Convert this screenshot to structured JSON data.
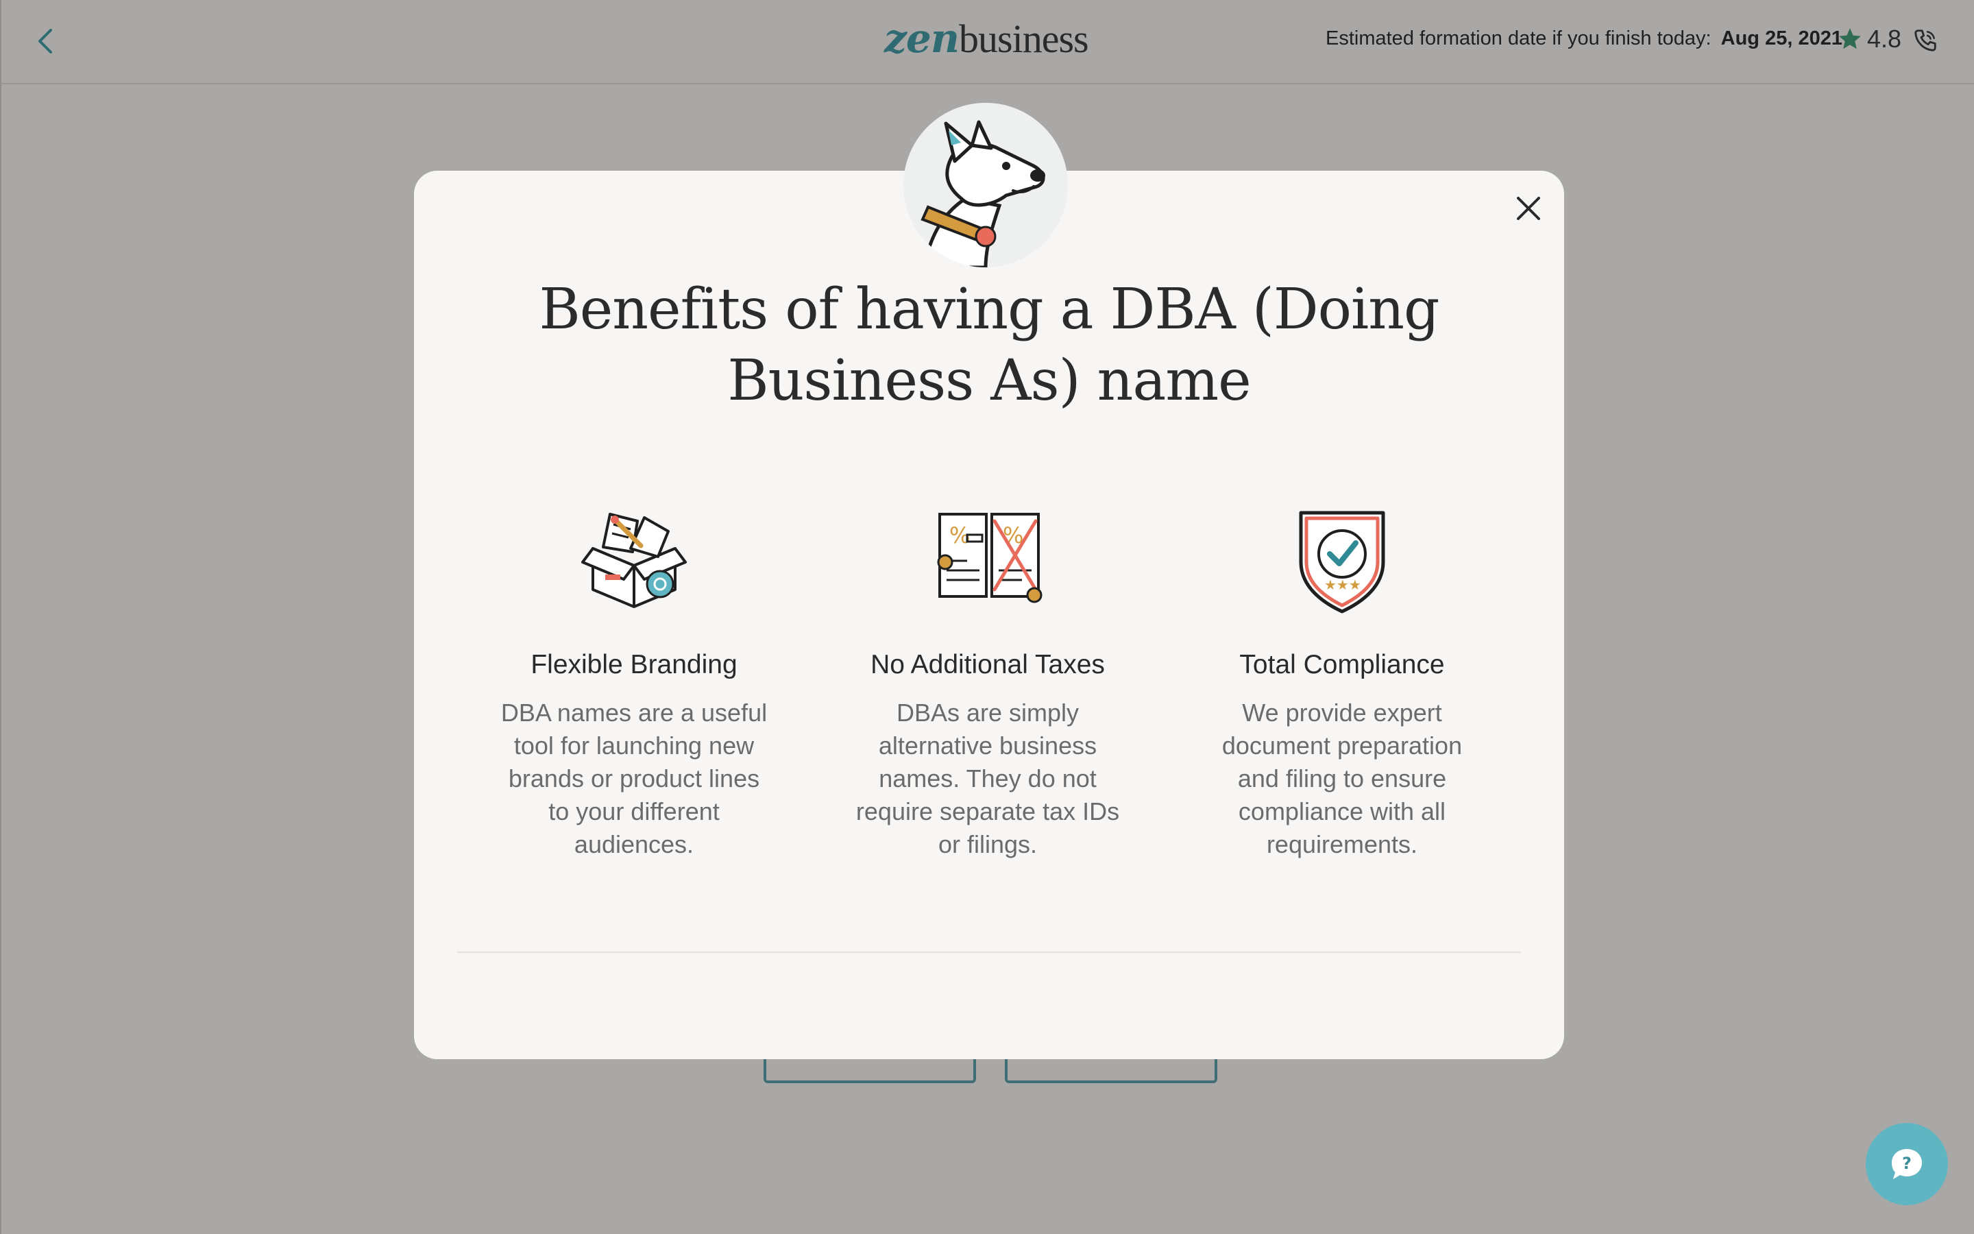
{
  "header": {
    "logo_prefix": "zen",
    "logo_suffix": "business",
    "formation_label": "Estimated formation date if you finish today:",
    "formation_date": "Aug 25, 2021",
    "rating": "4.8"
  },
  "modal": {
    "title": "Benefits of having a DBA (Doing Business As) name",
    "benefits": [
      {
        "title": "Flexible Branding",
        "description": "DBA names are a useful tool for launching new brands or product lines to your different audiences.",
        "icon": "open-box-icon"
      },
      {
        "title": "No Additional Taxes",
        "description": "DBAs are simply alternative business names. They do not require separate tax IDs or filings.",
        "icon": "tax-documents-icon"
      },
      {
        "title": "Total Compliance",
        "description": "We provide expert document preparation and filing to ensure compliance with all requirements.",
        "icon": "shield-check-icon"
      }
    ]
  },
  "colors": {
    "overlay": "#a9a8a6",
    "modal_bg": "#f7f6f4",
    "brand_teal": "#2f6b72",
    "help_button": "#5fb6c2"
  }
}
